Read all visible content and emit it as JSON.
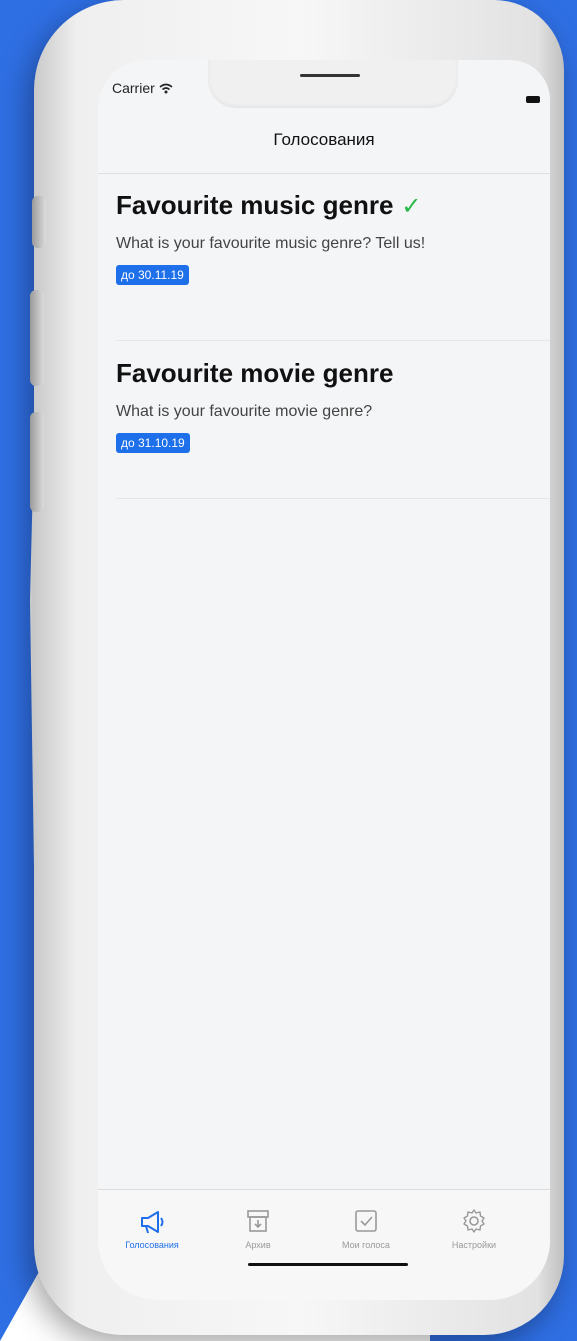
{
  "status_bar": {
    "carrier": "Carrier"
  },
  "nav": {
    "title": "Голосования"
  },
  "polls": [
    {
      "title": "Favourite music genre",
      "voted_mark": "✓",
      "description": "What is your favourite music genre? Tell us!",
      "deadline": "до 30.11.19"
    },
    {
      "title": "Favourite movie genre",
      "description": "What is your favourite movie genre?",
      "deadline": "до 31.10.19"
    }
  ],
  "tabbar": {
    "tabs": [
      {
        "label": "Голосования",
        "icon": "megaphone-icon",
        "active": true
      },
      {
        "label": "Архив",
        "icon": "archive-icon",
        "active": false
      },
      {
        "label": "Мои голоса",
        "icon": "checkbox-icon",
        "active": false
      },
      {
        "label": "Настройки",
        "icon": "gear-icon",
        "active": false
      }
    ]
  },
  "colors": {
    "accent": "#1e6fea",
    "check": "#27b84a",
    "background": "#2f6fe4"
  }
}
